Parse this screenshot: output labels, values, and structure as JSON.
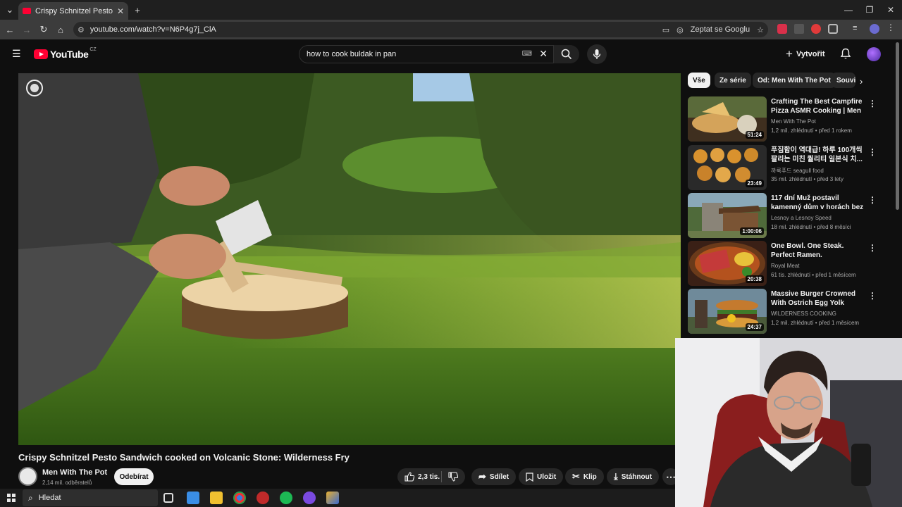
{
  "browser": {
    "tab_title": "Crispy Schnitzel Pesto Sandwich",
    "url": "youtube.com/watch?v=N6P4g7j_ClA",
    "ask_google": "Zeptat se Googlu"
  },
  "header": {
    "logo": "YouTube",
    "country": "CZ",
    "search_query": "how to cook buldak in pan",
    "create_label": "Vytvořit"
  },
  "video": {
    "title": "Crispy Schnitzel Pesto Sandwich cooked on Volcanic Stone: Wilderness Fry",
    "channel": "Men With The Pot",
    "subscribers": "2,14 mil. odběratelů",
    "subscribe_label": "Odebírat",
    "likes": "2,3 tis.",
    "share_label": "Sdílet",
    "save_label": "Uložit",
    "clip_label": "Klip",
    "download_label": "Stáhnout"
  },
  "chips": [
    "Vše",
    "Ze série",
    "Od: Men With The Pot",
    "Souvisejí"
  ],
  "recommendations": [
    {
      "title": "Crafting The Best Campfire Pizza ASMR Cooking | Men Wi...",
      "channel": "Men With The Pot",
      "meta": "1,2 mil. zhlédnutí • před 1 rokem",
      "duration": "51:24"
    },
    {
      "title": "푸짐함이 역대급! 하루 100개씩 팔리는 미친 퀄리티 일본식 치...",
      "channel": "까룩푸드 seagull food",
      "meta": "35 mil. zhlédnutí • před 3 lety",
      "duration": "23:49"
    },
    {
      "title": "117 dní Muž postavil kamenný dům v horách bez hřebíků",
      "channel": "Lesnoy a Lesnoy Speed",
      "meta": "18 mil. zhlédnutí • před 8 měsíci",
      "duration": "1:00:06"
    },
    {
      "title": "One Bowl. One Steak. Perfect Ramen.",
      "channel": "Royal Meat",
      "meta": "61 tis. zhlédnutí • před 1 měsícem",
      "duration": "20:38"
    },
    {
      "title": "Massive Burger Crowned With Ostrich Egg Yolk",
      "channel": "WILDERNESS COOKING",
      "meta": "1,2 mil. zhlédnutí • před 1 měsícem",
      "duration": "24:37"
    }
  ],
  "taskbar": {
    "search_placeholder": "Hledat"
  }
}
